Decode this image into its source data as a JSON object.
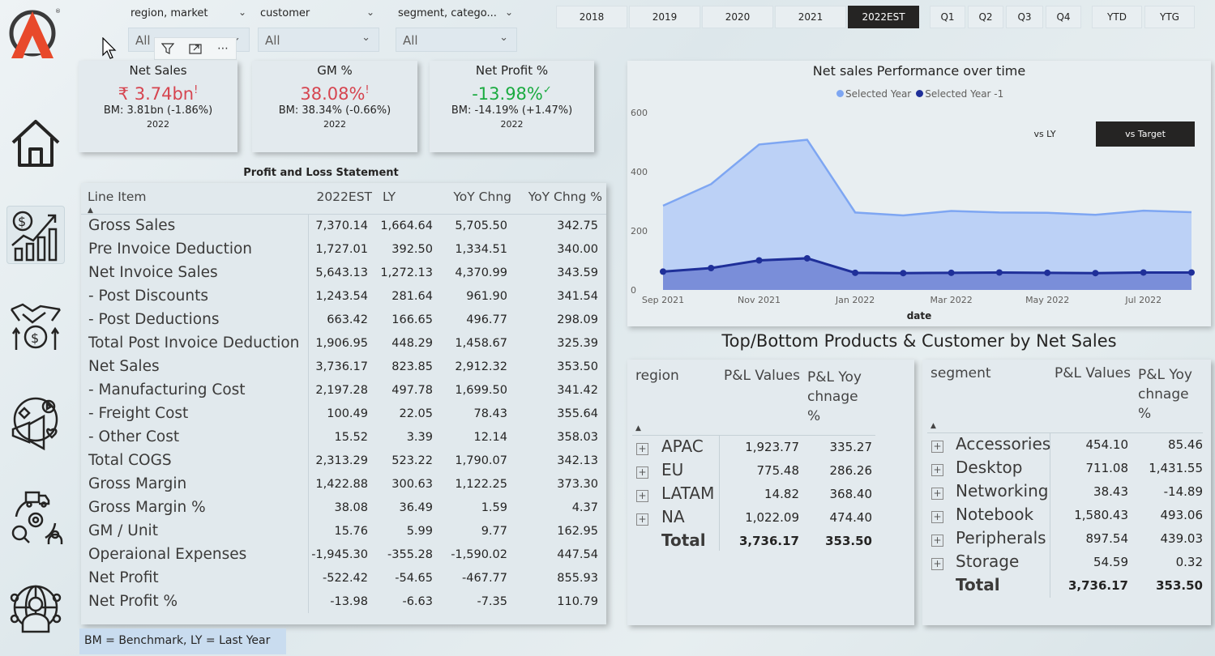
{
  "slicers": [
    {
      "title": "region, market",
      "value": "All"
    },
    {
      "title": "customer",
      "value": "All"
    },
    {
      "title": "segment, catego...",
      "value": "All"
    }
  ],
  "years": [
    "2018",
    "2019",
    "2020",
    "2021",
    "2022EST"
  ],
  "quarters": [
    "Q1",
    "Q2",
    "Q3",
    "Q4"
  ],
  "periods": [
    "YTD",
    "YTG"
  ],
  "selected_year": "2022EST",
  "kpis": [
    {
      "title": "Net Sales",
      "value": "₹ 3.74bn",
      "flag": "!",
      "bm": "BM: 3.81bn (-1.86%)",
      "year": "2022",
      "status_color": "#d64550"
    },
    {
      "title": "GM %",
      "value": "38.08%",
      "flag": "!",
      "bm": "BM: 38.34% (-0.66%)",
      "year": "2022",
      "status_color": "#d64550"
    },
    {
      "title": "Net Profit %",
      "value": "-13.98%",
      "flag": "✓",
      "bm": "BM: -14.19% (+1.47%)",
      "year": "2022",
      "status_color": "#1aab40"
    }
  ],
  "pl": {
    "title": "Profit and Loss Statement",
    "headers": [
      "Line Item",
      "2022EST",
      "LY",
      "YoY Chng",
      "YoY Chng %"
    ],
    "rows": [
      [
        "Gross Sales",
        "7,370.14",
        "1,664.64",
        "5,705.50",
        "342.75"
      ],
      [
        "Pre Invoice Deduction",
        "1,727.01",
        "392.50",
        "1,334.51",
        "340.00"
      ],
      [
        "Net Invoice Sales",
        "5,643.13",
        "1,272.13",
        "4,370.99",
        "343.59"
      ],
      [
        "- Post Discounts",
        "1,243.54",
        "281.64",
        "961.90",
        "341.54"
      ],
      [
        "- Post Deductions",
        "663.42",
        "166.65",
        "496.77",
        "298.09"
      ],
      [
        "Total Post Invoice Deduction",
        "1,906.95",
        "448.29",
        "1,458.67",
        "325.39"
      ],
      [
        "Net Sales",
        "3,736.17",
        "823.85",
        "2,912.32",
        "353.50"
      ],
      [
        "- Manufacturing Cost",
        "2,197.28",
        "497.78",
        "1,699.50",
        "341.42"
      ],
      [
        "- Freight Cost",
        "100.49",
        "22.05",
        "78.43",
        "355.64"
      ],
      [
        "- Other Cost",
        "15.52",
        "3.39",
        "12.14",
        "358.03"
      ],
      [
        "Total COGS",
        "2,313.29",
        "523.22",
        "1,790.07",
        "342.13"
      ],
      [
        "Gross Margin",
        "1,422.88",
        "300.63",
        "1,122.25",
        "373.30"
      ],
      [
        "Gross Margin %",
        "38.08",
        "36.49",
        "1.59",
        "4.37"
      ],
      [
        "GM / Unit",
        "15.76",
        "5.99",
        "9.77",
        "162.95"
      ],
      [
        "Operaional Expenses",
        "-1,945.30",
        "-355.28",
        "-1,590.02",
        "447.54"
      ],
      [
        "Net Profit",
        "-522.42",
        "-54.65",
        "-467.77",
        "855.93"
      ],
      [
        "Net Profit %",
        "-13.98",
        "-6.63",
        "-7.35",
        "110.79"
      ]
    ]
  },
  "chart": {
    "title": "Net sales Performance over time",
    "toggle_ly": "vs LY",
    "toggle_target": "vs Target",
    "chart_data": {
      "type": "area",
      "xlabel": "date",
      "ylabel": "",
      "ylim": [
        0,
        600
      ],
      "yticks": [
        "0",
        "200",
        "400",
        "600"
      ],
      "xticks": [
        "Sep 2021",
        "Nov 2021",
        "Jan 2022",
        "Mar 2022",
        "May 2022",
        "Jul 2022"
      ],
      "x": [
        "Sep 2021",
        "Oct 2021",
        "Nov 2021",
        "Dec 2021",
        "Jan 2022",
        "Feb 2022",
        "Mar 2022",
        "Apr 2022",
        "May 2022",
        "Jun 2022",
        "Jul 2022",
        "Aug 2022"
      ],
      "series": [
        {
          "name": "Selected Year",
          "color": "#7ea6f2",
          "values": [
            285,
            358,
            492,
            508,
            262,
            252,
            267,
            262,
            261,
            254,
            268,
            263
          ]
        },
        {
          "name": "Selected Year -1",
          "color": "#1f2f99",
          "values": [
            62,
            74,
            100,
            107,
            58,
            57,
            58,
            59,
            58,
            57,
            59,
            59
          ]
        }
      ]
    }
  },
  "section_title": "Top/Bottom Products & Customer by Net Sales",
  "region_table": {
    "headers": [
      "region",
      "P&L Values",
      "P&L Yoy chnage %"
    ],
    "rows": [
      [
        "APAC",
        "1,923.77",
        "335.27"
      ],
      [
        "EU",
        "775.48",
        "286.26"
      ],
      [
        "LATAM",
        "14.82",
        "368.40"
      ],
      [
        "NA",
        "1,022.09",
        "474.40"
      ]
    ],
    "total": [
      "Total",
      "3,736.17",
      "353.50"
    ]
  },
  "segment_table": {
    "headers": [
      "segment",
      "P&L Values",
      "P&L Yoy chnage %"
    ],
    "rows": [
      [
        "Accessories",
        "454.10",
        "85.46"
      ],
      [
        "Desktop",
        "711.08",
        "1,431.55"
      ],
      [
        "Networking",
        "38.43",
        "-14.89"
      ],
      [
        "Notebook",
        "1,580.43",
        "493.06"
      ],
      [
        "Peripherals",
        "897.54",
        "439.03"
      ],
      [
        "Storage",
        "54.59",
        "0.32"
      ]
    ],
    "total": [
      "Total",
      "3,736.17",
      "353.50"
    ]
  },
  "footnote": "BM = Benchmark, LY = Last Year"
}
